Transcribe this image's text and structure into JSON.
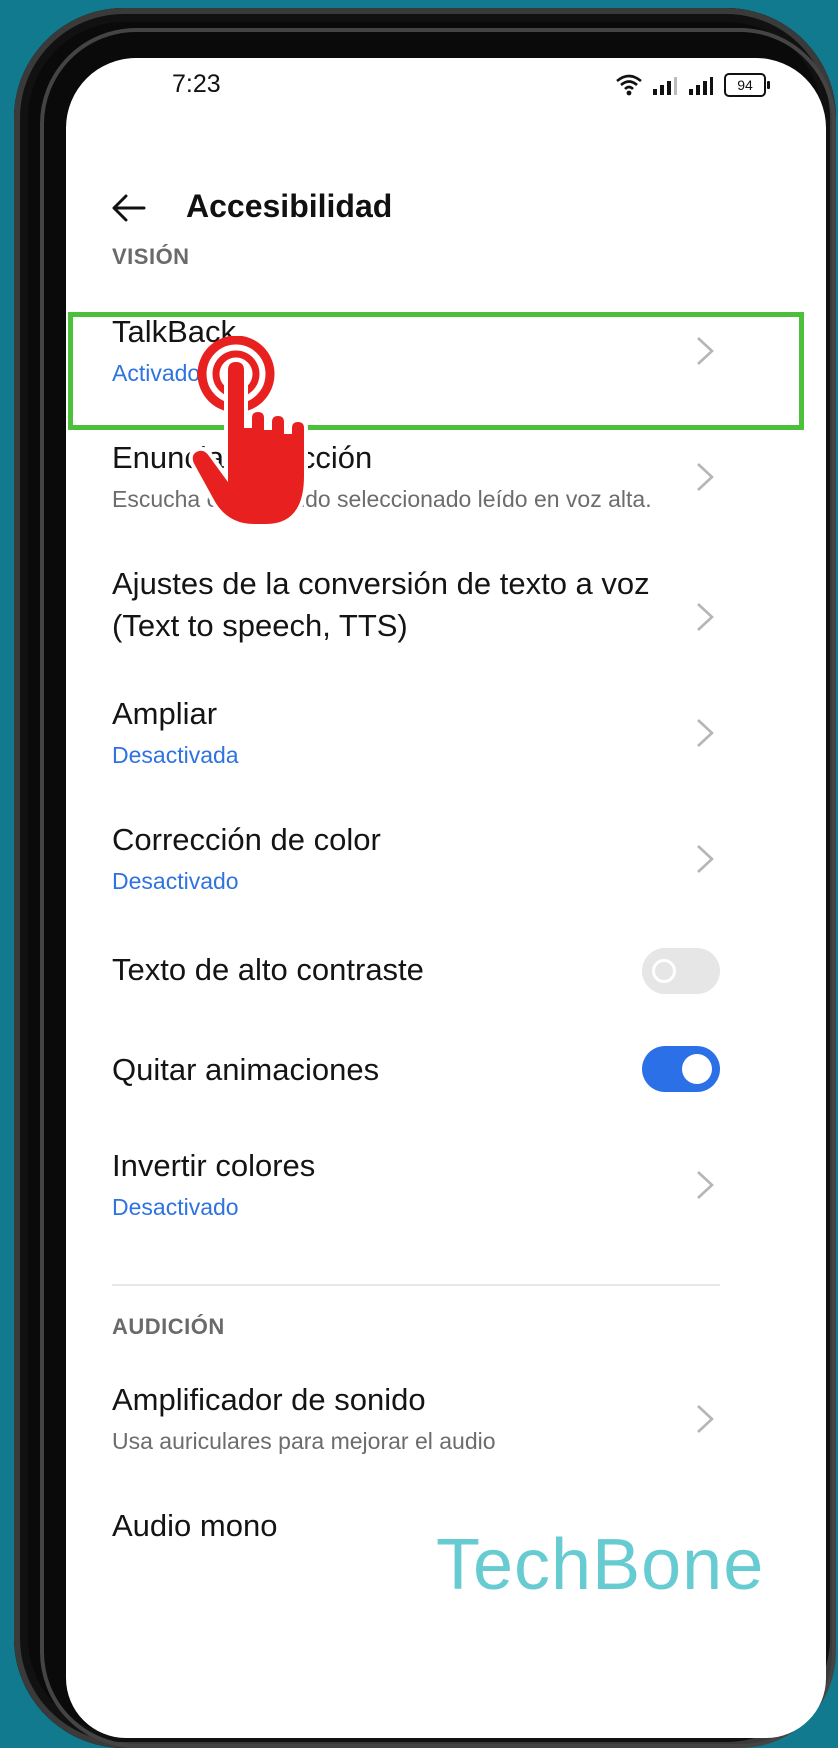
{
  "status_bar": {
    "time": "7:23",
    "battery": "94"
  },
  "header": {
    "title": "Accesibilidad"
  },
  "sections": {
    "vision": "VISIÓN",
    "audicion": "AUDICIÓN"
  },
  "rows": [
    {
      "title": "TalkBack",
      "subtitle": "Activado"
    },
    {
      "title": "Enunciar selección",
      "subtitle": "Escucha el contenido seleccionado leído en voz alta."
    },
    {
      "title": "Ajustes de la conversión de texto a voz",
      "title2": "(Text to speech, TTS)"
    },
    {
      "title": "Ampliar",
      "subtitle": "Desactivada"
    },
    {
      "title": "Corrección de color",
      "subtitle": "Desactivado"
    },
    {
      "title": "Texto de alto contraste",
      "toggle": "off"
    },
    {
      "title": "Quitar animaciones",
      "toggle": "on"
    },
    {
      "title": "Invertir colores",
      "subtitle": "Desactivado"
    },
    {
      "title": "Amplificador de sonido",
      "subtitle": "Usa auriculares para mejorar el audio"
    },
    {
      "title": "Audio mono"
    }
  ],
  "watermark": "TechBone",
  "colors": {
    "accent": "#2c70e8",
    "highlight": "#4cc03a",
    "tap_icon": "#e8201f",
    "background": "#127a8e"
  }
}
